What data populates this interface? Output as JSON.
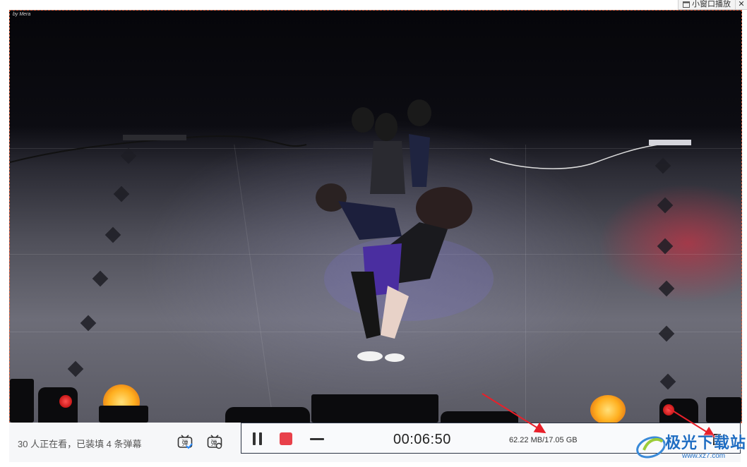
{
  "window": {
    "mini_window_label": "小窗口播放",
    "close_glyph": "✕"
  },
  "video": {
    "watermark": "by Mera"
  },
  "bottom_bar": {
    "viewer_text": "30 人正在看，已装填 4 条弹幕",
    "danmaku_icon_glyph": "弹"
  },
  "recorder": {
    "elapsed_time": "00:06:50",
    "file_size": "62.22 MB/17.05 GB"
  },
  "site_watermark": {
    "name": "极光下载站",
    "url": "www.xz7.com"
  },
  "colors": {
    "stop_button": "#e8404a",
    "annotation_arrow": "#e8202a",
    "recording_border": "#e0623f",
    "panel_border": "#2c3444",
    "watermark_blue": "#1f6dc2"
  },
  "icons": [
    "window-icon",
    "close-icon",
    "danmaku-icon",
    "danmaku-settings-icon",
    "pause-icon",
    "stop-icon",
    "minimize-icon",
    "edit-icon"
  ]
}
